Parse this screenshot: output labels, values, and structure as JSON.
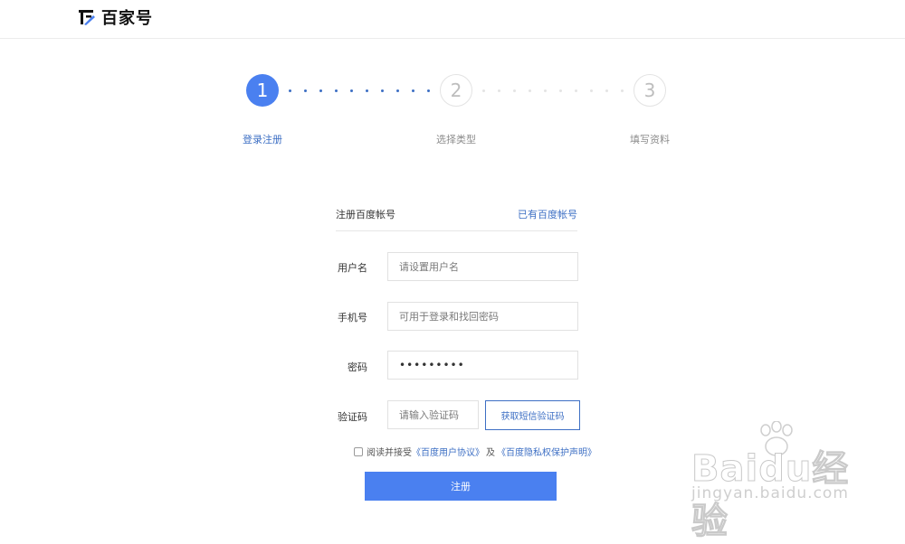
{
  "header": {
    "logo_text": "百家号"
  },
  "steps": [
    {
      "number": "1",
      "label": "登录注册",
      "state": "active"
    },
    {
      "number": "2",
      "label": "选择类型",
      "state": "inactive"
    },
    {
      "number": "3",
      "label": "填写资料",
      "state": "inactive"
    }
  ],
  "form": {
    "title": "注册百度帐号",
    "existing_account_link": "已有百度帐号",
    "username": {
      "label": "用户名",
      "placeholder": "请设置用户名",
      "value": ""
    },
    "phone": {
      "label": "手机号",
      "placeholder": "可用于登录和找回密码",
      "value": ""
    },
    "password": {
      "label": "密码",
      "value": "•••••••••"
    },
    "captcha": {
      "label": "验证码",
      "placeholder": "请输入验证码",
      "value": "",
      "sms_button": "获取短信验证码"
    },
    "agreement": {
      "prefix": "阅读并接受",
      "user_agreement": "《百度用户协议》",
      "conjunction": "及",
      "privacy_statement": "《百度隐私权保护声明》",
      "checked": false
    },
    "submit_label": "注册"
  },
  "watermark": {
    "brand": "Baidu经验",
    "url": "jingyan.baidu.com"
  },
  "colors": {
    "accent": "#4a80f0",
    "link": "#3d6fc4",
    "inactive": "#bdbdbd"
  }
}
